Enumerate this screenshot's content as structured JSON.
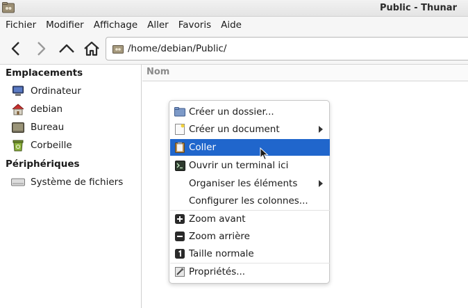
{
  "window": {
    "title": "Public - Thunar"
  },
  "menubar": {
    "items": [
      {
        "label": "Fichier"
      },
      {
        "label": "Modifier"
      },
      {
        "label": "Affichage"
      },
      {
        "label": "Aller"
      },
      {
        "label": "Favoris"
      },
      {
        "label": "Aide"
      }
    ]
  },
  "toolbar": {
    "location": "/home/debian/Public/"
  },
  "sidebar": {
    "sections": [
      {
        "title": "Emplacements"
      },
      {
        "title": "Périphériques"
      }
    ],
    "items": [
      {
        "label": "Ordinateur",
        "icon": "computer-icon"
      },
      {
        "label": "debian",
        "icon": "home-folder-icon"
      },
      {
        "label": "Bureau",
        "icon": "desktop-icon"
      },
      {
        "label": "Corbeille",
        "icon": "trash-icon"
      },
      {
        "label": "Système de fichiers",
        "icon": "drive-icon"
      }
    ]
  },
  "main": {
    "column_header": "Nom"
  },
  "context_menu": {
    "items": [
      {
        "label": "Créer un dossier...",
        "icon": "new-folder-icon"
      },
      {
        "label": "Créer un document",
        "icon": "new-document-icon",
        "submenu": true
      },
      {
        "label": "Coller",
        "icon": "paste-icon",
        "selected": true
      },
      {
        "label": "Ouvrir un terminal ici",
        "icon": "terminal-icon"
      },
      {
        "label": "Organiser les éléments",
        "submenu": true
      },
      {
        "label": "Configurer les colonnes..."
      },
      {
        "label": "Zoom avant",
        "icon": "zoom-in-icon"
      },
      {
        "label": "Zoom arrière",
        "icon": "zoom-out-icon"
      },
      {
        "label": "Taille normale",
        "icon": "zoom-normal-icon"
      },
      {
        "label": "Propriétés...",
        "icon": "properties-icon"
      }
    ]
  },
  "colors": {
    "selection": "#2066cc",
    "title_text": "#2a2a2a"
  }
}
